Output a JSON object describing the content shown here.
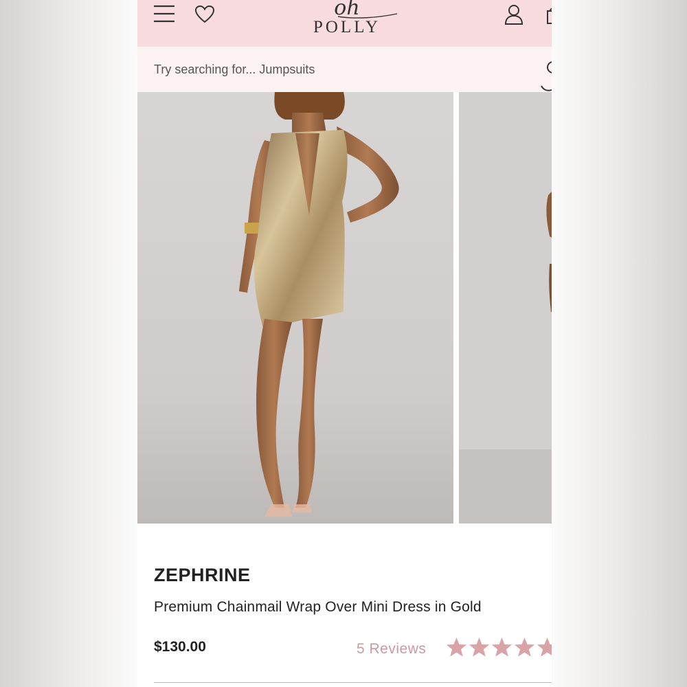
{
  "header": {
    "logo_script": "oh",
    "logo_main": "POLLY"
  },
  "search": {
    "placeholder": "Try searching for... Jumpsuits"
  },
  "product": {
    "brand": "ZEPHRINE",
    "title": "Premium Chainmail Wrap Over Mini Dress in Gold",
    "price": "$130.00",
    "reviews": "5 Reviews",
    "rating": 5
  },
  "colors": {
    "header_bg": "#f9dce0",
    "search_bg": "#fdf3f4",
    "accent": "#c99a9e"
  },
  "icons": [
    "menu-icon",
    "heart-icon",
    "account-icon",
    "bag-icon",
    "search-icon",
    "star-icon"
  ]
}
